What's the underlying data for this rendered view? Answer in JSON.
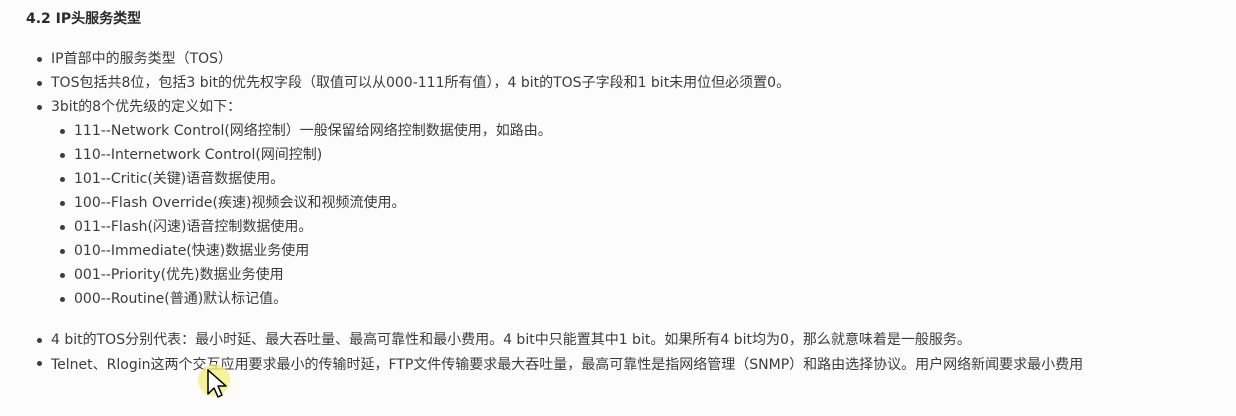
{
  "section": {
    "title": "4.2 IP头服务类型"
  },
  "bullets": [
    "IP首部中的服务类型（TOS）",
    "TOS包括共8位，包括3 bit的优先权字段（取值可以从000-111所有值），4 bit的TOS子字段和1 bit未用位但必须置0。",
    "3bit的8个优先级的定义如下："
  ],
  "priority_levels": [
    "111--Network Control(网络控制）一般保留给网络控制数据使用，如路由。",
    "110--Internetwork Control(网间控制)",
    "101--Critic(关键)语音数据使用。",
    "100--Flash Override(疾速)视频会议和视频流使用。",
    "011--Flash(闪速)语音控制数据使用。",
    "010--Immediate(快速)数据业务使用",
    "001--Priority(优先)数据业务使用",
    "000--Routine(普通)默认标记值。"
  ],
  "bullets_after": [
    "4 bit的TOS分别代表：最小时延、最大吞吐量、最高可靠性和最小费用。4 bit中只能置其中1 bit。如果所有4 bit均为0，那么就意味着是一般服务。",
    "Telnet、Rlogin这两个交互应用要求最小的传输时延，FTP文件传输要求最大吞吐量，最高可靠性是指网络管理（SNMP）和路由选择协议。用户网络新闻要求最小费用"
  ],
  "cursor": {
    "icon": "mouse-pointer-icon",
    "highlight_color": "#f3ef7a"
  }
}
